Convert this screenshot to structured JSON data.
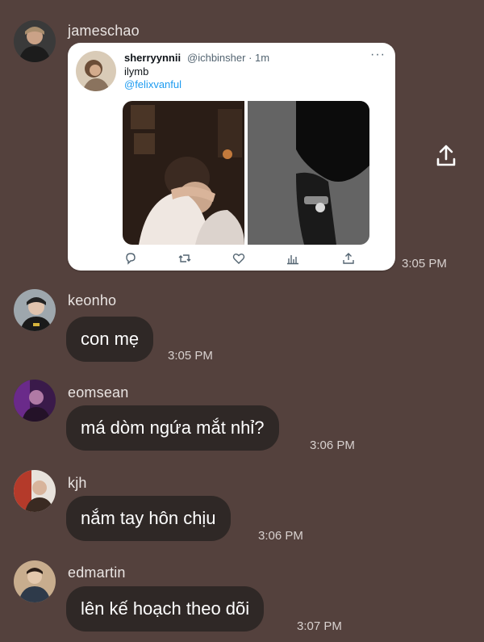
{
  "messages": [
    {
      "username": "jameschao",
      "time": "3:05 PM"
    },
    {
      "username": "keonho",
      "text": "con mẹ",
      "time": "3:05 PM"
    },
    {
      "username": "eomsean",
      "text": "má dòm ngứa mắt nhỉ?",
      "time": "3:06 PM"
    },
    {
      "username": "kjh",
      "text": "nắm tay hôn chịu",
      "time": "3:06 PM"
    },
    {
      "username": "edmartin",
      "text": "lên kế hoạch theo dõi",
      "time": "3:07 PM"
    }
  ],
  "tweet": {
    "name": "sherryynnii",
    "handle": "@ichbinsher · 1m",
    "text": "ilymb",
    "mention": "@felixvanful",
    "more": "···"
  },
  "icons": {
    "share": "share-upload-icon",
    "reply": "reply-icon",
    "retweet": "retweet-icon",
    "like": "heart-icon",
    "views": "views-icon",
    "tweet_share": "share-icon"
  },
  "colors": {
    "background": "#54413d",
    "bubble": "#2f2826",
    "link": "#1d9bf0"
  }
}
